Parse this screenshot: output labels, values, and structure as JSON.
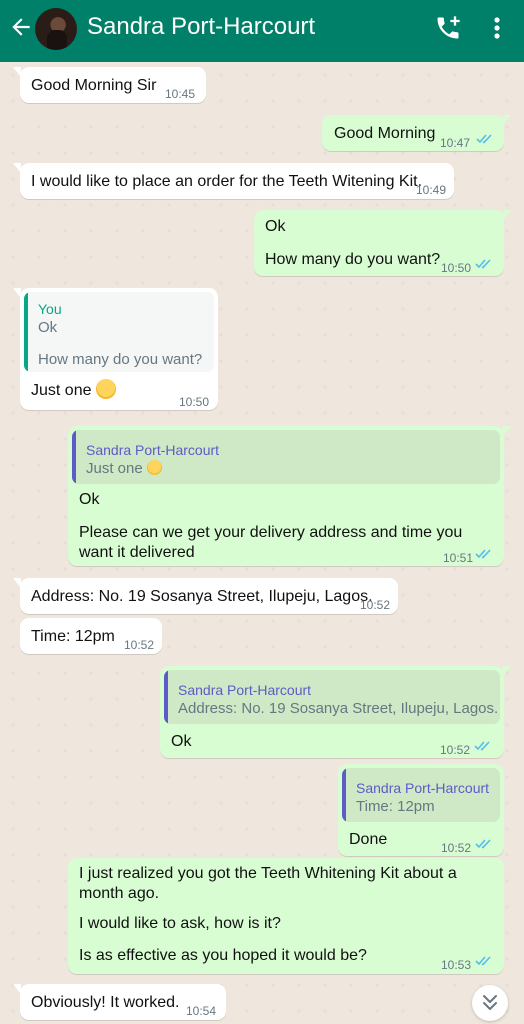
{
  "header": {
    "contact_name": "Sandra Port-Harcourt",
    "back_icon": "arrow-left-icon",
    "call_icon": "add-call-icon",
    "menu_icon": "more-vert-icon",
    "bg_color": "#008069"
  },
  "colors": {
    "incoming": "#ffffff",
    "outgoing": "#d9fdd3",
    "tick_read": "#53bdeb",
    "reply_you": "#06a884",
    "reply_contact": "#5e5ac8"
  },
  "messages": [
    {
      "dir": "in",
      "text": "Good Morning Sir",
      "time": "10:45"
    },
    {
      "dir": "out",
      "text": "Good Morning",
      "time": "10:47"
    },
    {
      "dir": "in",
      "text": "I would like to place an order for the Teeth Witening Kit.",
      "time": "10:49"
    },
    {
      "dir": "out",
      "line1": "Ok",
      "line2": "How many do you want?",
      "time": "10:50"
    },
    {
      "dir": "in",
      "reply_name": "You",
      "reply_line1": "Ok",
      "reply_line2": "How many do you want?",
      "text": "Just one",
      "time": "10:50"
    },
    {
      "dir": "out",
      "reply_name": "Sandra Port-Harcourt",
      "reply_text": "Just one",
      "line1": "Ok",
      "line2": "Please can we get your delivery address and time you want it delivered",
      "time": "10:51"
    },
    {
      "dir": "in",
      "text": "Address: No. 19 Sosanya Street, Ilupeju, Lagos.",
      "time": "10:52"
    },
    {
      "dir": "in",
      "text": "Time: 12pm",
      "time": "10:52"
    },
    {
      "dir": "out",
      "reply_name": "Sandra Port-Harcourt",
      "reply_text": "Address: No. 19 Sosanya Street, Ilupeju, Lagos.",
      "text": "Ok",
      "time": "10:52"
    },
    {
      "dir": "out",
      "reply_name": "Sandra Port-Harcourt",
      "reply_text": "Time: 12pm",
      "text": "Done",
      "time": "10:52"
    },
    {
      "dir": "out",
      "line1": "I just realized you got the Teeth Whitening Kit about a month ago.",
      "line2": "I would like to ask, how is it?",
      "line3": "Is as effective as you hoped it would be?",
      "time": "10:53"
    },
    {
      "dir": "in",
      "text": "Obviously! It worked.",
      "time": "10:54"
    }
  ],
  "scroll_button_icon": "double-chevron-down-icon"
}
